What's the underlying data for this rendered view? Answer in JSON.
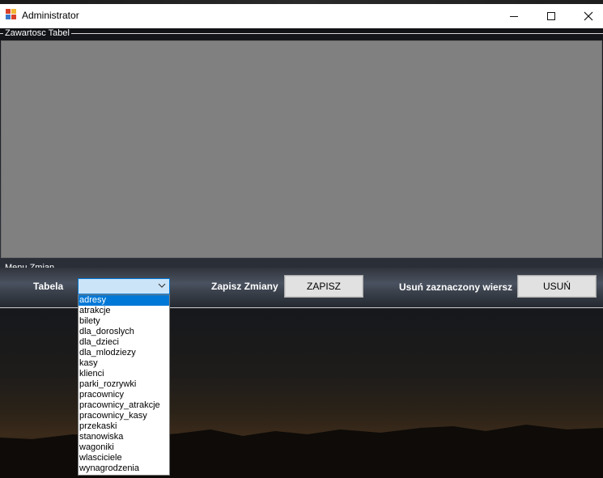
{
  "window": {
    "title": "Administrator",
    "icon": "app-icon",
    "minimize_icon": "minimize-icon",
    "maximize_icon": "maximize-icon",
    "close_icon": "close-icon"
  },
  "table_group": {
    "legend": "Zawartosc Tabel"
  },
  "menu_group": {
    "legend": "Menu Zmian",
    "table_label": "Tabela",
    "table_selected": "",
    "save_label": "Zapisz Zmiany",
    "save_button": "ZAPISZ",
    "delete_label": "Usuń zaznaczony wiersz",
    "delete_button": "USUŃ"
  },
  "dropdown": {
    "selected_index": 0,
    "options": [
      "adresy",
      "atrakcje",
      "bilety",
      "dla_doroslych",
      "dla_dzieci",
      "dla_mlodziezy",
      "kasy",
      "klienci",
      "parki_rozrywki",
      "pracownicy",
      "pracownicy_atrakcje",
      "pracownicy_kasy",
      "przekaski",
      "stanowiska",
      "wagoniki",
      "wlasciciele",
      "wynagrodzenia"
    ]
  },
  "colors": {
    "selection": "#0078d7",
    "grid_background": "#808080",
    "button_face": "#e1e1e1"
  }
}
